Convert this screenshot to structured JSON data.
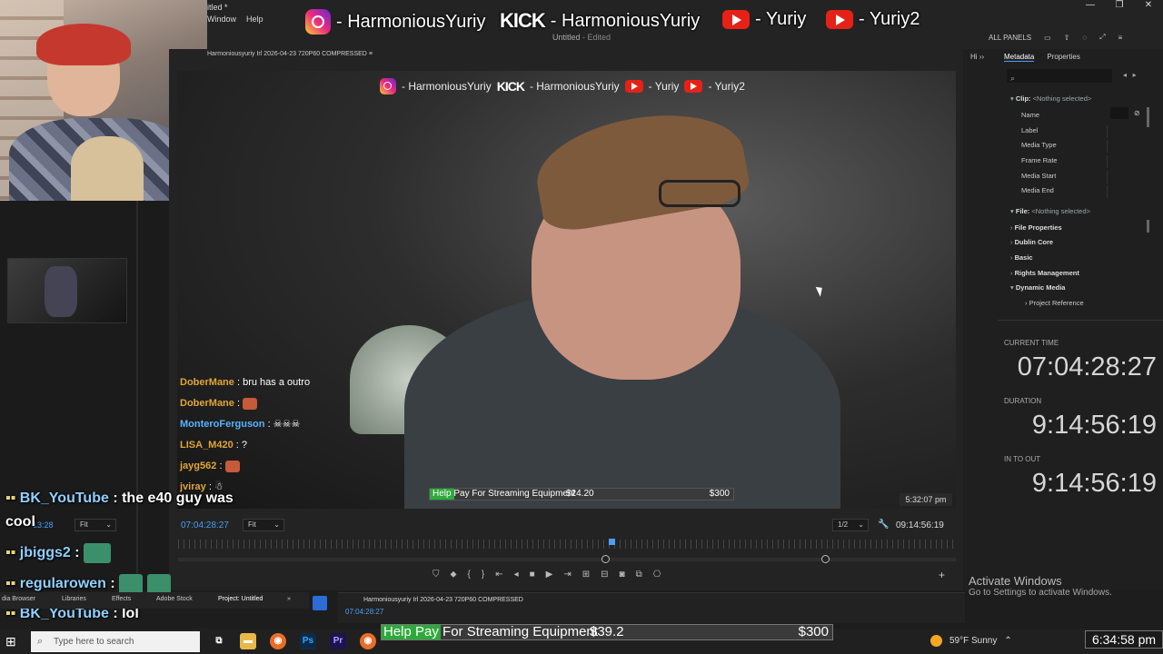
{
  "app": {
    "doc_title_top": "itled *",
    "menu": [
      "Window",
      "Help"
    ],
    "center_title": "Untitled",
    "center_status": "- Edited",
    "right_toolbar": [
      "ALL PANELS"
    ],
    "window_controls": [
      "—",
      "❐",
      "✕"
    ]
  },
  "stream_socials": {
    "instagram": "- HarmoniousYuriy",
    "kick_logo": "KICK",
    "kick": "- HarmoniousYuriy",
    "youtube1": "- Yuriy",
    "youtube2": "- Yuriy2"
  },
  "program_monitor": {
    "tab_title": "Harmoniousyuriy Irl 2026-04-23 720P60 COMPRESSED",
    "timestamp_overlay": "5:32:07 pm",
    "current_tc": "07:04:28:27",
    "fit_label": "Fit",
    "resolution": "1/2",
    "duration_tc": "09:14:56:19"
  },
  "left_source": {
    "tc": "13:28",
    "fit_label": "Fit"
  },
  "video_socials": {
    "instagram": "- HarmoniousYuriy",
    "kick_logo": "KICK",
    "kick": "- HarmoniousYuriy",
    "youtube1": "- Yuriy",
    "youtube2": "- Yuriy2"
  },
  "video_chat": [
    {
      "name": "DoberMane",
      "text": ": bru has a outro",
      "style": "gold"
    },
    {
      "name": "DoberMane",
      "text": ":",
      "style": "gold"
    },
    {
      "name": "MonteroFerguson",
      "text": ":",
      "style": "blue"
    },
    {
      "name": "LISA_M420",
      "text": ": ?",
      "style": "gold"
    },
    {
      "name": "jayg562",
      "text": ":",
      "style": "gold"
    },
    {
      "name": "jviray",
      "text": ":",
      "style": "gold"
    }
  ],
  "small_goal": {
    "label": "Help Pay For Streaming Equipment",
    "amount": "$24.20",
    "goal": "$300",
    "progress": 0.081
  },
  "metadata_panel": {
    "tabs": [
      "Metadata",
      "Properties"
    ],
    "clip_header": "Clip:",
    "clip_value": "<Nothing selected>",
    "clip_fields": [
      "Name",
      "Label",
      "Media Type",
      "Frame Rate",
      "Media Start",
      "Media End"
    ],
    "file_header": "File:",
    "file_value": "<Nothing selected>",
    "sections": [
      "File Properties",
      "Dublin Core",
      "Basic",
      "Rights Management",
      "Dynamic Media"
    ],
    "subsection": "Project Reference"
  },
  "time_display": {
    "current_label": "CURRENT TIME",
    "current": "07:04:28:27",
    "duration_label": "DURATION",
    "duration": "9:14:56:19",
    "inout_label": "IN TO OUT",
    "inout": "9:14:56:19"
  },
  "activate": {
    "title": "Activate Windows",
    "sub": "Go to Settings to activate Windows."
  },
  "stream_chat": [
    {
      "name": "BK_YouTube",
      "text": ": the e40 guy was"
    },
    {
      "name": "",
      "text": "cool"
    },
    {
      "name": "jbiggs2",
      "text": ":"
    },
    {
      "name": "regularowen",
      "text": ":"
    },
    {
      "name": "BK_YouTube",
      "text": ": lol"
    }
  ],
  "bottom_tabs": [
    "dia Browser",
    "Libraries",
    "Effects",
    "Adobe Stock",
    "Project: Untitled"
  ],
  "timeline": {
    "title": "Harmoniousyuriy Irl 2026-04-23 720P60 COMPRESSED",
    "tc": "07:04:28:27"
  },
  "taskbar": {
    "search_placeholder": "Type here to search",
    "weather": "59°F  Sunny",
    "clock": "6:34:58 pm"
  },
  "big_goal": {
    "label": "Help Pay For Streaming Equipment",
    "amount": "$39.2",
    "goal": "$300",
    "progress": 0.131
  },
  "colors": {
    "accent_blue": "#4a9ff5",
    "goal_green": "#2eaa3c",
    "chat_name_gold": "#e0a636"
  }
}
